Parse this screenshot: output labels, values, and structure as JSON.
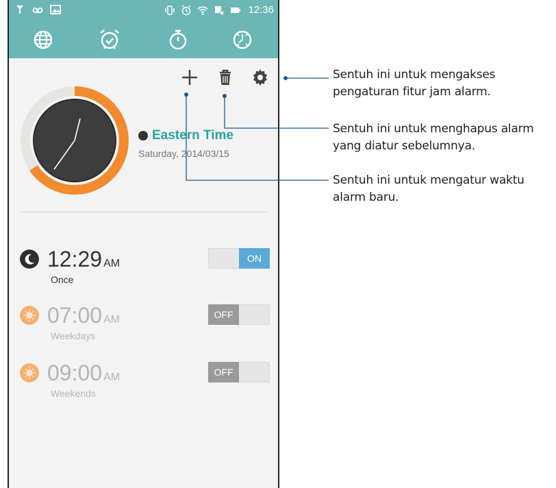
{
  "status_bar": {
    "left_icons": [
      "signal-icon",
      "voicemail-icon",
      "image-icon"
    ],
    "right_icons": [
      "vibrate-icon",
      "alarm-icon",
      "wifi-icon",
      "data-icon",
      "battery-icon"
    ],
    "time": "12:36"
  },
  "tabs": [
    {
      "name": "world-clock",
      "icon": "globe-icon"
    },
    {
      "name": "alarm",
      "icon": "alarm-clock-icon",
      "active": true
    },
    {
      "name": "stopwatch",
      "icon": "stopwatch-icon"
    },
    {
      "name": "timer",
      "icon": "timer-icon"
    }
  ],
  "toolbar": {
    "add_icon": "plus-icon",
    "delete_icon": "trash-icon",
    "settings_icon": "gear-icon"
  },
  "clock": {
    "timezone": "Eastern Time",
    "date": "Saturday, 2014/03/15"
  },
  "alarms": [
    {
      "time": "12:29",
      "ampm": "AM",
      "repeat": "Once",
      "state": "ON",
      "icon": "moon-icon",
      "enabled": true
    },
    {
      "time": "07:00",
      "ampm": "AM",
      "repeat": "Weekdays",
      "state": "OFF",
      "icon": "sun-icon",
      "enabled": false
    },
    {
      "time": "09:00",
      "ampm": "AM",
      "repeat": "Weekends",
      "state": "OFF",
      "icon": "sun-icon",
      "enabled": false
    }
  ],
  "callouts": {
    "settings_line1": "Sentuh ini untuk mengakses",
    "settings_line2": "pengaturan fitur jam alarm.",
    "delete_line1": "Sentuh ini untuk menghapus alarm",
    "delete_line2": "yang diatur sebelumnya.",
    "add_line1": "Sentuh ini untuk mengatur waktu",
    "add_line2": "alarm baru."
  },
  "colors": {
    "header": "#6bb7b6",
    "accent_teal": "#29a3a3",
    "dial_ring": "#f28a2e",
    "toggle_on": "#5aa9d6",
    "toggle_off": "#9a9a9a",
    "sun_icon": "#f5b070"
  }
}
